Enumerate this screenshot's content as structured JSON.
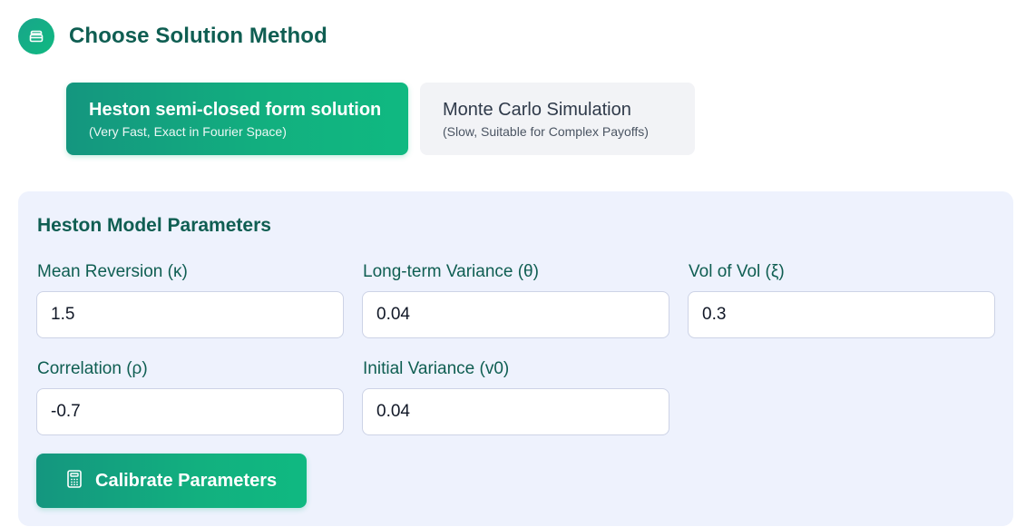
{
  "header": {
    "icon": "layers-icon",
    "title": "Choose Solution Method"
  },
  "methods": [
    {
      "title": "Heston semi-closed form solution",
      "subtitle": "(Very Fast, Exact in Fourier Space)",
      "selected": true
    },
    {
      "title": "Monte Carlo Simulation",
      "subtitle": "(Slow, Suitable for Complex Payoffs)",
      "selected": false
    }
  ],
  "params": {
    "title": "Heston Model Parameters",
    "fields": [
      {
        "label": "Mean Reversion (κ)",
        "value": "1.5"
      },
      {
        "label": "Long-term Variance (θ)",
        "value": "0.04"
      },
      {
        "label": "Vol of Vol (ξ)",
        "value": "0.3"
      },
      {
        "label": "Correlation (ρ)",
        "value": "-0.7"
      },
      {
        "label": "Initial Variance (v0)",
        "value": "0.04"
      }
    ],
    "calibrate_button": {
      "icon": "calculator-icon",
      "label": "Calibrate Parameters"
    }
  },
  "colors": {
    "accent_start": "#14967f",
    "accent_end": "#10b981",
    "heading": "#0f5e52",
    "panel_bg": "#eef2fd",
    "inactive_bg": "#f2f3f6"
  }
}
